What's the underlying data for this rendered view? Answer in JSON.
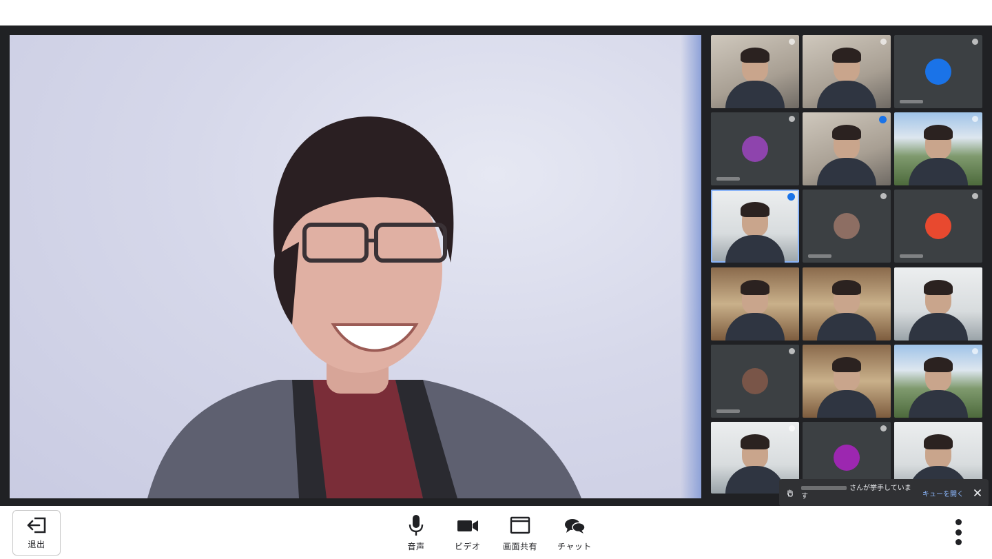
{
  "meeting": {
    "main_participant": "active-speaker",
    "tiles": [
      {
        "kind": "video",
        "muted": true
      },
      {
        "kind": "video",
        "muted": true
      },
      {
        "kind": "avatar",
        "color": "#1a73e8",
        "muted": true
      },
      {
        "kind": "avatar",
        "color": "#8e44ad",
        "muted": true
      },
      {
        "kind": "video",
        "speaking": true
      },
      {
        "kind": "video",
        "muted": true
      },
      {
        "kind": "video",
        "speaking": true,
        "active": true
      },
      {
        "kind": "avatar",
        "color": "#8d6e63",
        "muted": true
      },
      {
        "kind": "avatar",
        "color": "#e8492f",
        "muted": true
      },
      {
        "kind": "video"
      },
      {
        "kind": "video"
      },
      {
        "kind": "video"
      },
      {
        "kind": "avatar",
        "color": "#795548",
        "muted": true
      },
      {
        "kind": "video"
      },
      {
        "kind": "video",
        "muted": true
      },
      {
        "kind": "video",
        "muted": true
      },
      {
        "kind": "avatar",
        "color": "#9c27b0",
        "muted": true
      },
      {
        "kind": "video"
      }
    ]
  },
  "notification": {
    "message_suffix": "さんが挙手していま",
    "message_wrap": "す",
    "open_queue_label": "キューを開く",
    "hand_icon": "raised-hand-icon",
    "close_icon": "close-icon"
  },
  "toolbar": {
    "exit_label": "退出",
    "audio_label": "音声",
    "video_label": "ビデオ",
    "share_label": "画面共有",
    "chat_label": "チャット"
  },
  "colors": {
    "stage_bg": "#202124",
    "tile_bg": "#3c4043",
    "accent": "#8ab4f8"
  }
}
